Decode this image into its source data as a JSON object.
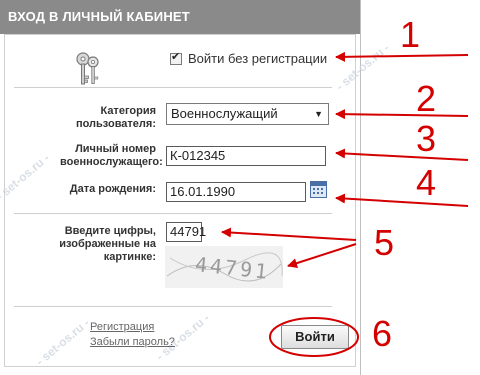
{
  "panel": {
    "title": "ВХОД В ЛИЧНЫЙ КАБИНЕТ"
  },
  "form": {
    "no_registration_label": "Войти без регистрации",
    "no_registration_checked": true,
    "category_label_line1": "Категория",
    "category_label_line2": "пользователя:",
    "category_value": "Военнослужащий",
    "personal_number_label_line1": "Личный номер",
    "personal_number_label_line2": "военнослужащего:",
    "personal_number_value": "К-012345",
    "birthdate_label": "Дата рождения:",
    "birthdate_value": "16.01.1990",
    "captcha_label_line1": "Введите цифры,",
    "captcha_label_line2": "изображенные на",
    "captcha_label_line3": "картинке:",
    "captcha_input_value": "44791",
    "captcha_image_text": "44791",
    "register_link": "Регистрация",
    "forgot_link": "Забыли пароль?",
    "login_button": "Войти"
  },
  "annotations": {
    "n1": "1",
    "n2": "2",
    "n3": "3",
    "n4": "4",
    "n5": "5",
    "n6": "6",
    "color": "#d40000"
  },
  "watermark": {
    "text": "- set-os.ru -"
  },
  "colors": {
    "header_bg": "#8a8a8a",
    "annotation_red": "#d40000"
  },
  "icons": {
    "keys": "keys-icon",
    "calendar": "calendar-icon",
    "dropdown": "chevron-down-icon"
  }
}
